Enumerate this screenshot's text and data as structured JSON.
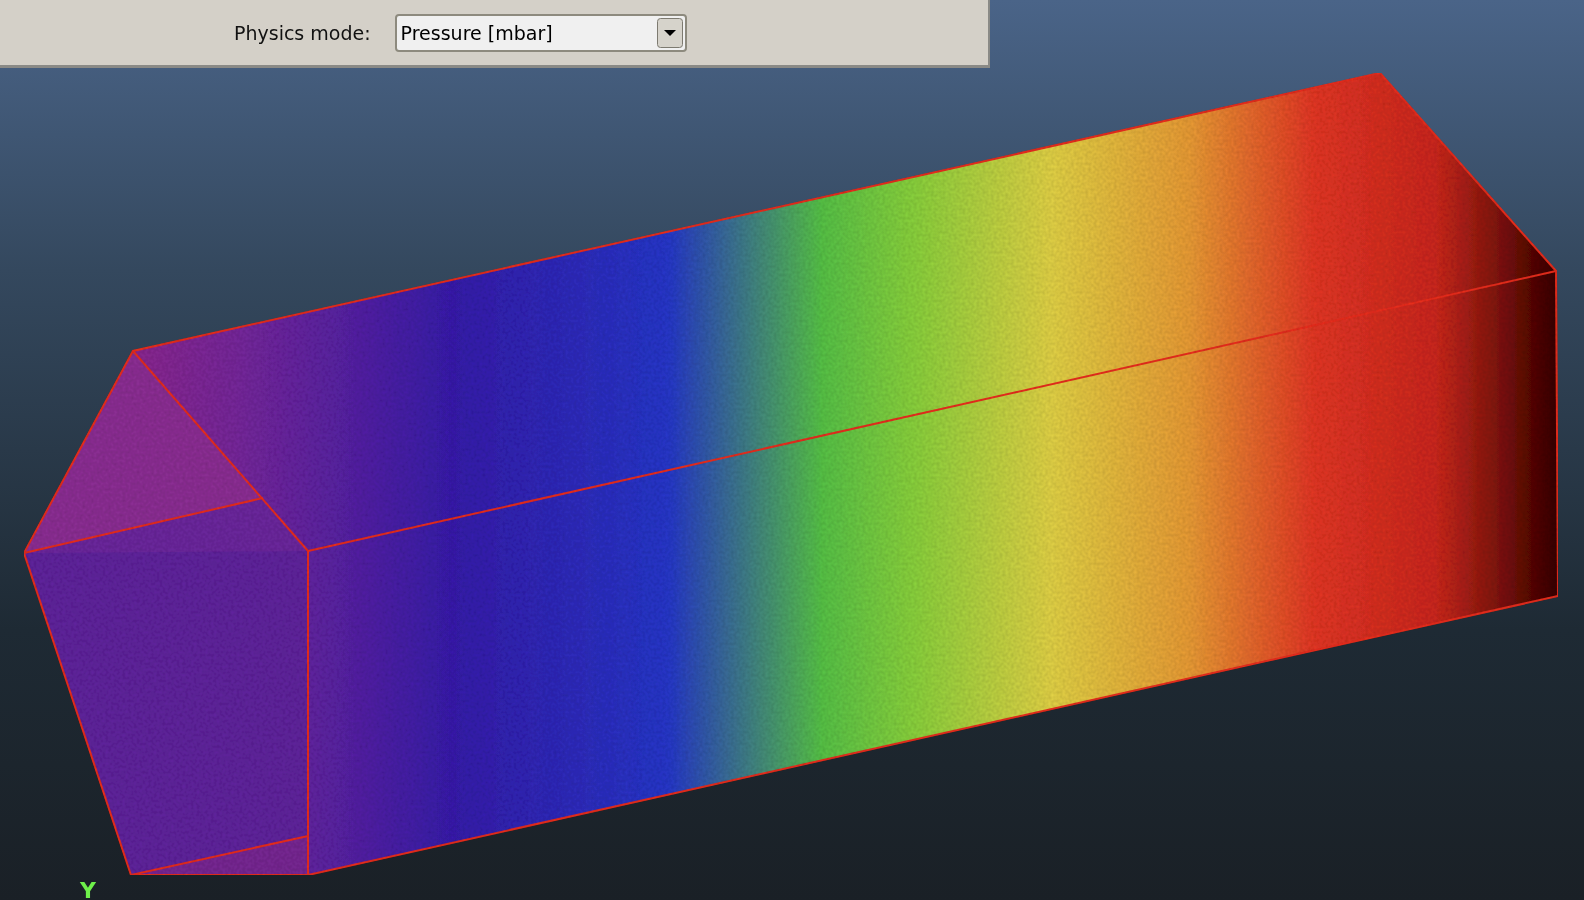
{
  "toolbar": {
    "label": "Physics mode:",
    "dropdown": {
      "value": "Pressure [mbar]"
    }
  },
  "viewport": {
    "axis_label": "Y"
  }
}
